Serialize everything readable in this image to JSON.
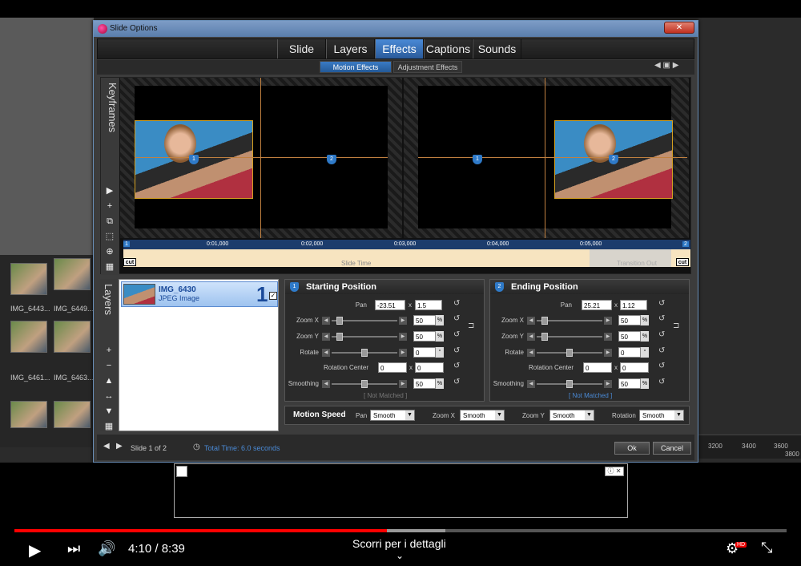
{
  "dialog": {
    "title": "Slide Options",
    "close_label": "✕",
    "tabs": [
      {
        "label": "Slide"
      },
      {
        "label": "Layers"
      },
      {
        "label": "Effects"
      },
      {
        "label": "Captions"
      },
      {
        "label": "Sounds"
      }
    ],
    "active_tab": "Effects",
    "subtabs": [
      {
        "label": "Motion Effects"
      },
      {
        "label": "Adjustment Effects"
      }
    ],
    "active_subtab": "Motion Effects",
    "accent_color": "#2f7ac8"
  },
  "preview": {
    "keyframes_label": "Keyframes",
    "marker_1": "1",
    "marker_2": "2"
  },
  "timeline": {
    "start_marker": "1",
    "end_marker": "2",
    "ticks": [
      "0:01,000",
      "0:02,000",
      "0:03,000",
      "0:04,000",
      "0:05,000"
    ],
    "slide_time_label": "Slide Time",
    "transition_label": "Transition Out",
    "cut_label": "cut"
  },
  "layers": {
    "label": "Layers",
    "items": [
      {
        "name": "IMG_6430",
        "type": "JPEG Image",
        "number": "1",
        "checked": true
      }
    ]
  },
  "starting": {
    "badge": "1",
    "title": "Starting Position",
    "pan_label": "Pan",
    "pan_x": "-23.51",
    "pan_y": "1.5",
    "zoom_x_label": "Zoom X",
    "zoom_x": "50",
    "zoom_y_label": "Zoom Y",
    "zoom_y": "50",
    "rotate_label": "Rotate",
    "rotate": "0",
    "rotation_center_label": "Rotation Center",
    "rc_x": "0",
    "rc_y": "0",
    "smoothing_label": "Smoothing",
    "smoothing": "50",
    "match_status": "[ Not Matched ]"
  },
  "ending": {
    "badge": "2",
    "title": "Ending Position",
    "pan_label": "Pan",
    "pan_x": "25.21",
    "pan_y": "1.12",
    "zoom_x_label": "Zoom X",
    "zoom_x": "50",
    "zoom_y_label": "Zoom Y",
    "zoom_y": "50",
    "rotate_label": "Rotate",
    "rotate": "0",
    "rotation_center_label": "Rotation Center",
    "rc_x": "0",
    "rc_y": "0",
    "smoothing_label": "Smoothing",
    "smoothing": "50",
    "match_status": "[ Not Matched ]"
  },
  "units": {
    "percent": "%",
    "degree": "°",
    "x": "x"
  },
  "motion_speed": {
    "label": "Motion Speed",
    "pan_label": "Pan",
    "pan": "Smooth",
    "zoom_x_label": "Zoom X",
    "zoom_x": "Smooth",
    "zoom_y_label": "Zoom Y",
    "zoom_y": "Smooth",
    "rotation_label": "Rotation",
    "rotation": "Smooth"
  },
  "footer": {
    "slide_counter": "Slide 1 of 2",
    "total_time": "Total Time: 6.0 seconds",
    "ok_label": "Ok",
    "cancel_label": "Cancel"
  },
  "background": {
    "thumbs": [
      "IMG_6443...",
      "IMG_6449...",
      "IMG_6461...",
      "IMG_6463..."
    ],
    "ruler": [
      "3200",
      "3400",
      "3600",
      "3800"
    ]
  },
  "player": {
    "time": "4:10 / 8:39",
    "scroll_hint": "Scorri per i dettagli",
    "progress": 0.482,
    "buffered": 0.558,
    "hd_badge": "HD",
    "progress_color": "#ff0000"
  }
}
